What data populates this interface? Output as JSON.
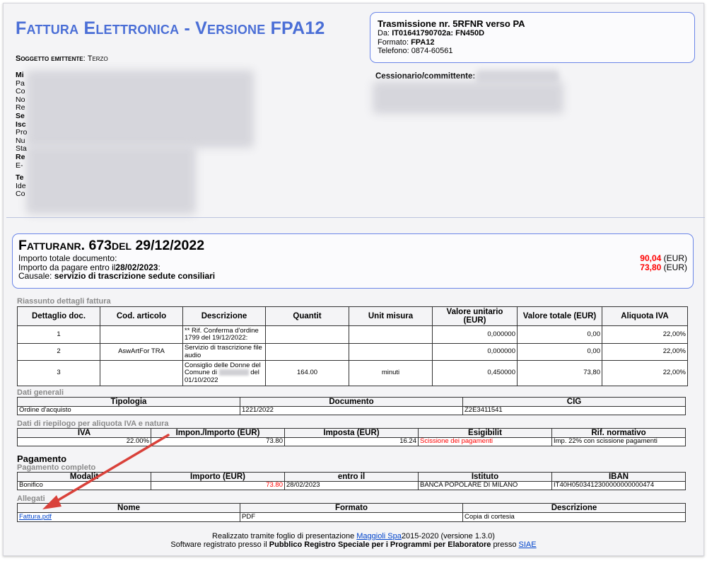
{
  "header": {
    "title": "Fattura Elettronica - Versione FPA12",
    "soggetto_label": "Soggetto emittente",
    "soggetto_value": "Terzo",
    "left_letters": [
      "Mi",
      "Pa",
      "Co",
      "No",
      "Re",
      "Se",
      "Isc",
      "Pro",
      "Nu",
      "Sta",
      "Re",
      "E-",
      "Te",
      "Ide",
      "Co"
    ]
  },
  "trasmissione": {
    "title": "Trasmissione nr. 5RFNR verso PA",
    "da_label": "Da:",
    "da_value": "IT01641790702a: FN450D",
    "formato_label": "Formato:",
    "formato_value": "FPA12",
    "telefono_label": "Telefono:",
    "telefono_value": "0874-60561"
  },
  "cessionario": {
    "label": "Cessionario/committente:"
  },
  "fattura": {
    "title_prefix": "Fattura",
    "title_rest": "nr. 673",
    "title_del": "del",
    "date": "29/12/2022",
    "importo_totale_label": "Importo totale documento:",
    "importo_totale_value": "90,04",
    "importo_pagare_label": "Importo da pagare entro il",
    "importo_pagare_date": "28/02/2023",
    "importo_pagare_value": "73,80",
    "currency": "(EUR)",
    "causale_label": "Causale:",
    "causale_value": "servizio di trascrizione sedute consiliari"
  },
  "riassunto": {
    "section_title": "Riassunto dettagli fattura",
    "headers": [
      "Dettaglio doc.",
      "Cod. articolo",
      "Descrizione",
      "Quantit",
      "Unit misura",
      "Valore unitario (EUR)",
      "Valore totale (EUR)",
      "Aliquota IVA"
    ],
    "rows": [
      {
        "n": "1",
        "cod": "",
        "desc": "** Rif. Conferma d'ordine 1799 del 19/12/2022:",
        "qta": "",
        "um": "",
        "vu": "0,000000",
        "vt": "0,00",
        "iva": "22,00%"
      },
      {
        "n": "2",
        "cod": "AswArtFor TRA",
        "desc": "Servizio di trascrizione file audio",
        "qta": "",
        "um": "",
        "vu": "0,000000",
        "vt": "0,00",
        "iva": "22,00%"
      },
      {
        "n": "3",
        "cod": "",
        "desc_a": "Consiglio delle Donne del Comune di",
        "desc_b": "del",
        "desc_c": "01/10/2022",
        "qta": "164.00",
        "um": "minuti",
        "vu": "0,450000",
        "vt": "73,80",
        "iva": "22,00%"
      }
    ]
  },
  "dati_generali": {
    "section_title": "Dati generali",
    "headers": [
      "Tipologia",
      "Documento",
      "CIG"
    ],
    "row": [
      "Ordine d'acquisto",
      "1221/2022",
      "Z2E3411541"
    ]
  },
  "riepilogo": {
    "section_title": "Dati di riepilogo per aliquota IVA e natura",
    "headers": [
      "IVA",
      "Impon./Importo (EUR)",
      "Imposta (EUR)",
      "Esigibilit",
      "Rif. normativo"
    ],
    "row": [
      "22.00%",
      "73.80",
      "16.24",
      "Scissione dei pagamenti",
      "Imp. 22% con scissione pagamenti"
    ]
  },
  "pagamento": {
    "title": "Pagamento",
    "section_title": "Pagamento completo",
    "headers": [
      "Modalit",
      "Importo (EUR)",
      "entro il",
      "Istituto",
      "IBAN"
    ],
    "row": [
      "Bonifico",
      "73.80",
      "28/02/2023",
      "BANCA POPOLARE DI MILANO",
      "IT40H0503412300000000000474"
    ]
  },
  "allegati": {
    "section_title": "Allegati",
    "headers": [
      "Nome",
      "Formato",
      "Descrizione"
    ],
    "row": [
      "Fattura.pdf",
      "PDF",
      "Copia di cortesia"
    ]
  },
  "footer": {
    "line1_prefix": "Realizzato tramite foglio di presentazione",
    "line1_link": "Maggioli Spa",
    "line1_suffix": "2015-2020 (versione 1.3.0)",
    "line2_prefix": "Software registrato presso il",
    "line2_bold": "Pubblico Registro Speciale per i Programmi per Elaboratore",
    "line2_mid": "presso",
    "line2_link": "SIAE"
  },
  "colors": {
    "title": "#4a6ed6",
    "border": "#6b86e8",
    "amount": "#ff0000",
    "arrow": "#d9413a"
  }
}
